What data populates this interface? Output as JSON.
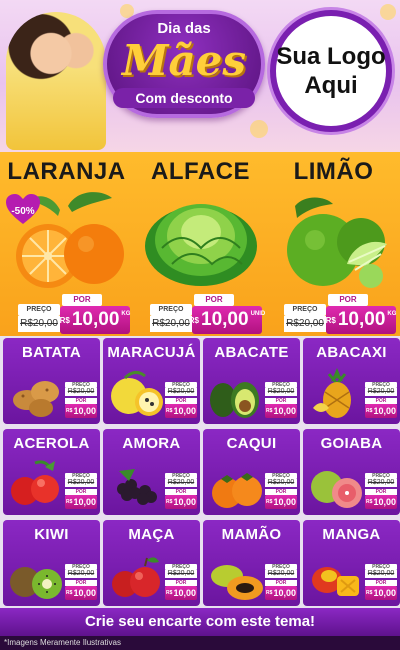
{
  "header": {
    "badge_top": "Dia das",
    "badge_main": "Mães",
    "badge_bottom": "Com desconto",
    "logo_line1": "Sua Logo",
    "logo_line2": "Aqui"
  },
  "colors": {
    "purple": "#7a1fb0",
    "orange": "#f9a21b",
    "magenta": "#c4189a",
    "gold": "#ffcf3a"
  },
  "featured": [
    {
      "name": "LARANJA",
      "discount": "-50%",
      "price_label": "PREÇO",
      "old_price": "R$20,00",
      "por_label": "POR",
      "currency": "R$",
      "new_price": "10,00",
      "unit": "KG",
      "icon": "orange-icon"
    },
    {
      "name": "ALFACE",
      "price_label": "PREÇO",
      "old_price": "R$20,00",
      "por_label": "POR",
      "currency": "R$",
      "new_price": "10,00",
      "unit": "UNID",
      "icon": "lettuce-icon"
    },
    {
      "name": "LIMÃO",
      "price_label": "PREÇO",
      "old_price": "R$20,00",
      "por_label": "POR",
      "currency": "R$",
      "new_price": "10,00",
      "unit": "KG",
      "icon": "lime-icon"
    }
  ],
  "products": [
    {
      "name": "BATATA",
      "icon": "potato-icon",
      "price_label": "PREÇO",
      "old_price": "R$20,00",
      "por_label": "POR",
      "currency": "R$",
      "new_price": "10,00"
    },
    {
      "name": "MARACUJÁ",
      "icon": "passion-fruit-icon",
      "price_label": "PREÇO",
      "old_price": "R$20,00",
      "por_label": "POR",
      "currency": "R$",
      "new_price": "10,00"
    },
    {
      "name": "ABACATE",
      "icon": "avocado-icon",
      "price_label": "PREÇO",
      "old_price": "R$20,00",
      "por_label": "POR",
      "currency": "R$",
      "new_price": "10,00"
    },
    {
      "name": "ABACAXI",
      "icon": "pineapple-icon",
      "price_label": "PREÇO",
      "old_price": "R$20,00",
      "por_label": "POR",
      "currency": "R$",
      "new_price": "10,00"
    },
    {
      "name": "ACEROLA",
      "icon": "acerola-icon",
      "price_label": "PREÇO",
      "old_price": "R$20,00",
      "por_label": "POR",
      "currency": "R$",
      "new_price": "10,00"
    },
    {
      "name": "AMORA",
      "icon": "blackberry-icon",
      "price_label": "PREÇO",
      "old_price": "R$20,00",
      "por_label": "POR",
      "currency": "R$",
      "new_price": "10,00"
    },
    {
      "name": "CAQUI",
      "icon": "persimmon-icon",
      "price_label": "PREÇO",
      "old_price": "R$20,00",
      "por_label": "POR",
      "currency": "R$",
      "new_price": "10,00"
    },
    {
      "name": "GOIABA",
      "icon": "guava-icon",
      "price_label": "PREÇO",
      "old_price": "R$20,00",
      "por_label": "POR",
      "currency": "R$",
      "new_price": "10,00"
    },
    {
      "name": "KIWI",
      "icon": "kiwi-icon",
      "price_label": "PREÇO",
      "old_price": "R$20,00",
      "por_label": "POR",
      "currency": "R$",
      "new_price": "10,00"
    },
    {
      "name": "MAÇA",
      "icon": "apple-icon",
      "price_label": "PREÇO",
      "old_price": "R$20,00",
      "por_label": "POR",
      "currency": "R$",
      "new_price": "10,00"
    },
    {
      "name": "MAMÃO",
      "icon": "papaya-icon",
      "price_label": "PREÇO",
      "old_price": "R$20,00",
      "por_label": "POR",
      "currency": "R$",
      "new_price": "10,00"
    },
    {
      "name": "MANGA",
      "icon": "mango-icon",
      "price_label": "PREÇO",
      "old_price": "R$20,00",
      "por_label": "POR",
      "currency": "R$",
      "new_price": "10,00"
    }
  ],
  "footer": {
    "cta": "Crie seu encarte com este tema!",
    "disclaimer": "*Imagens Meramente Ilustrativas"
  }
}
